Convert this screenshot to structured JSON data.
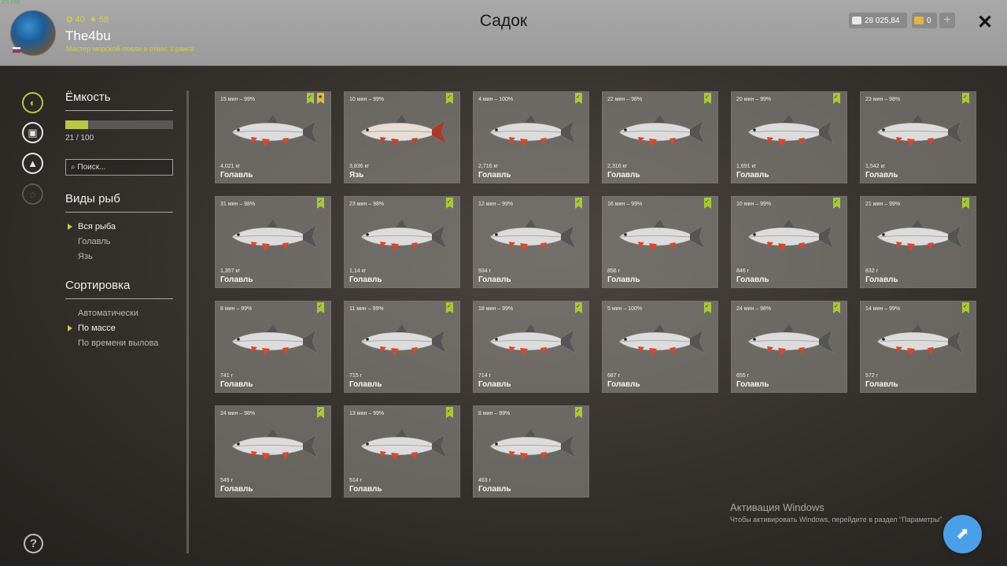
{
  "fps": "276 FPS",
  "player": {
    "level": "40",
    "stars": "58",
    "name": "The4bu",
    "title": "Мастер морской ловли в отвес 3 ранга"
  },
  "screen_title": "Садок",
  "currency": {
    "silver": "28 025,84",
    "gold": "0"
  },
  "capacity": {
    "label": "Ёмкость",
    "text": "21 / 100",
    "fill_fraction": 0.21
  },
  "search": {
    "placeholder": "Поиск..."
  },
  "species_filter": {
    "title": "Виды рыб",
    "options": [
      "Вся рыба",
      "Голавль",
      "Язь"
    ],
    "selected": 0
  },
  "sort": {
    "title": "Сортировка",
    "options": [
      "Автоматически",
      "По массе",
      "По времени вылова"
    ],
    "selected": 1
  },
  "fish": [
    {
      "meta": "15 мин – 99%",
      "weight": "4,021 кг",
      "species": "Голавль",
      "trophy": true
    },
    {
      "meta": "10 мин – 99%",
      "weight": "3,836 кг",
      "species": "Язь",
      "trophy": false
    },
    {
      "meta": "4 мин – 100%",
      "weight": "2,716 кг",
      "species": "Голавль",
      "trophy": false
    },
    {
      "meta": "22 мин – 98%",
      "weight": "2,316 кг",
      "species": "Голавль",
      "trophy": false
    },
    {
      "meta": "20 мин – 99%",
      "weight": "1,691 кг",
      "species": "Голавль",
      "trophy": false
    },
    {
      "meta": "23 мин – 98%",
      "weight": "1,542 кг",
      "species": "Голавль",
      "trophy": false
    },
    {
      "meta": "31 мин – 98%",
      "weight": "1,357 кг",
      "species": "Голавль",
      "trophy": false
    },
    {
      "meta": "23 мин – 98%",
      "weight": "1,14 кг",
      "species": "Голавль",
      "trophy": false
    },
    {
      "meta": "12 мин – 99%",
      "weight": "934 г",
      "species": "Голавль",
      "trophy": false
    },
    {
      "meta": "16 мин – 99%",
      "weight": "856 г",
      "species": "Голавль",
      "trophy": false
    },
    {
      "meta": "10 мин – 99%",
      "weight": "846 г",
      "species": "Голавль",
      "trophy": false
    },
    {
      "meta": "21 мин – 99%",
      "weight": "832 г",
      "species": "Голавль",
      "trophy": false
    },
    {
      "meta": "8 мин – 99%",
      "weight": "741 г",
      "species": "Голавль",
      "trophy": false
    },
    {
      "meta": "11 мин – 99%",
      "weight": "715 г",
      "species": "Голавль",
      "trophy": false
    },
    {
      "meta": "18 мин – 99%",
      "weight": "714 г",
      "species": "Голавль",
      "trophy": false
    },
    {
      "meta": "5 мин – 100%",
      "weight": "687 г",
      "species": "Голавль",
      "trophy": false
    },
    {
      "meta": "24 мин – 98%",
      "weight": "655 г",
      "species": "Голавль",
      "trophy": false
    },
    {
      "meta": "14 мин – 99%",
      "weight": "572 г",
      "species": "Голавль",
      "trophy": false
    },
    {
      "meta": "24 мин – 98%",
      "weight": "549 г",
      "species": "Голавль",
      "trophy": false
    },
    {
      "meta": "13 мин – 99%",
      "weight": "514 г",
      "species": "Голавль",
      "trophy": false
    },
    {
      "meta": "8 мин – 99%",
      "weight": "463 г",
      "species": "Голавль",
      "trophy": false
    }
  ],
  "windows_watermark": {
    "title": "Активация Windows",
    "subtitle": "Чтобы активировать Windows, перейдите в раздел \"Параметры\""
  },
  "icons": {
    "nav": [
      "fish-icon",
      "backpack-icon",
      "tent-icon",
      "home-icon"
    ],
    "help": "help-icon",
    "close": "close-icon",
    "fab": "cursor-icon"
  },
  "colors": {
    "accent": "#b8c840",
    "badge": "#a8c83a",
    "trophy_badge": "#e8b838"
  }
}
